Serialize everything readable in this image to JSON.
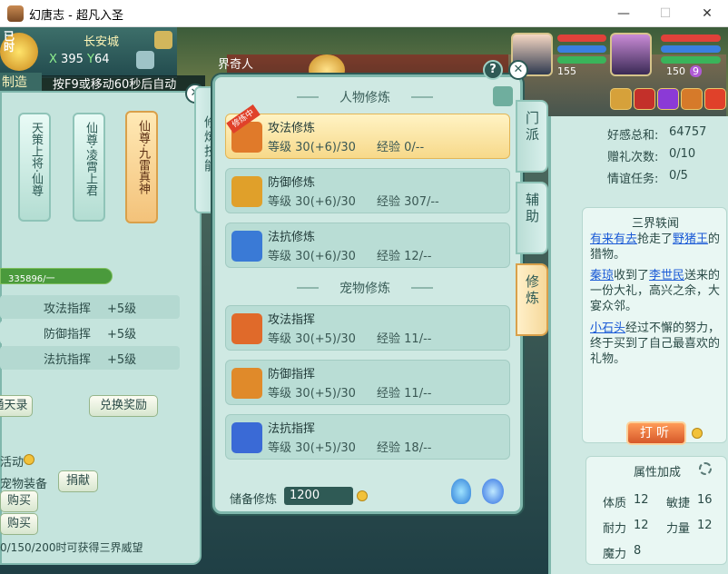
{
  "window": {
    "title": "幻唐志 - 超凡入圣",
    "minimize": "—",
    "maximize": "☐",
    "close": "✕"
  },
  "hud": {
    "time_label": "已时",
    "city": "长安城",
    "coord_x_label": "X",
    "coord_x": "395",
    "coord_y_label": "Y",
    "coord_y": "64",
    "make_label": "制造",
    "notice": "按F9或移动60秒后自动",
    "area_name": "界奇人",
    "player_level": "155",
    "pet_level": "150",
    "pet_badge": "9"
  },
  "left_panel": {
    "titles": [
      {
        "label": "天策上将·仙尊",
        "selected": false
      },
      {
        "label": "仙尊·凌霄上君",
        "selected": false
      },
      {
        "label": "仙尊·九雷真神",
        "selected": true
      }
    ],
    "progress_text": "335896/一",
    "rows": [
      {
        "name": "攻法指挥",
        "value": "+5级"
      },
      {
        "name": "防御指挥",
        "value": "+5级"
      },
      {
        "name": "法抗指挥",
        "value": "+5级"
      }
    ],
    "btn_record": "通天录",
    "btn_exchange": "兑换奖励",
    "activity_label": "活动",
    "pet_equip_label": "宠物装备",
    "btn_donate": "捐献",
    "btn_buy1": "购买",
    "btn_buy2": "购买",
    "footer": "0/150/200时可获得三界威望"
  },
  "vtab_label": "修炼技能",
  "center_panel": {
    "section_char": "人物修炼",
    "section_pet": "宠物修炼",
    "level_label": "等级",
    "exp_label": "经验",
    "char_items": [
      {
        "name": "攻法修炼",
        "level": "30(+6)/30",
        "exp": "0/--",
        "selected": true,
        "badge": "修炼中"
      },
      {
        "name": "防御修炼",
        "level": "30(+6)/30",
        "exp": "307/--",
        "selected": false
      },
      {
        "name": "法抗修炼",
        "level": "30(+6)/30",
        "exp": "12/--",
        "selected": false
      }
    ],
    "pet_items": [
      {
        "name": "攻法指挥",
        "level": "30(+5)/30",
        "exp": "11/--"
      },
      {
        "name": "防御指挥",
        "level": "30(+5)/30",
        "exp": "11/--"
      },
      {
        "name": "法抗指挥",
        "level": "30(+5)/30",
        "exp": "18/--"
      }
    ],
    "store_label": "储备修炼",
    "store_value": "1200"
  },
  "right_tabs": [
    {
      "label": "门派",
      "selected": false
    },
    {
      "label": "辅助",
      "selected": false
    },
    {
      "label": "修炼",
      "selected": true
    }
  ],
  "right_panel": {
    "stats": [
      {
        "label": "好感总和:",
        "value": "64757"
      },
      {
        "label": "赠礼次数:",
        "value": "0/10"
      },
      {
        "label": "情谊任务:",
        "value": "0/5"
      }
    ],
    "news_title": "三界轶闻",
    "news": [
      {
        "p1": "有来有去",
        "t1": "抢走了",
        "p2": "野猪王",
        "t2": "的猎物。"
      },
      {
        "p1": "秦琼",
        "t1": "收到了",
        "p2": "李世民",
        "t2": "送来的一份大礼，高兴之余，大宴众邻。"
      },
      {
        "p1": "小石头",
        "t1": "经过不懈的努力，终于买到了自己最喜欢的礼物。",
        "p2": "",
        "t2": ""
      }
    ],
    "btn_listen": "打听",
    "attr_title": "属性加成",
    "attrs": [
      {
        "name": "体质",
        "value": "12"
      },
      {
        "name": "敏捷",
        "value": "16"
      },
      {
        "name": "耐力",
        "value": "12"
      },
      {
        "name": "力量",
        "value": "12"
      },
      {
        "name": "魔力",
        "value": "8"
      }
    ]
  },
  "colors": {
    "panel": "#cfe9e3",
    "accent": "#f7d98a",
    "link": "#1a5ad6",
    "listen_btn": "#e06a34"
  }
}
